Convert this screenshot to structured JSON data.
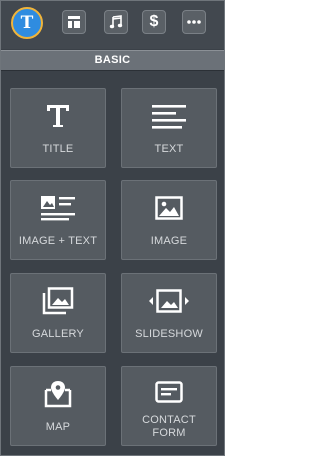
{
  "toolbar": {
    "buttons": [
      {
        "name": "text-elements",
        "glyph": "T",
        "active": true
      },
      {
        "name": "layout-elements",
        "active": false
      },
      {
        "name": "media-elements",
        "active": false
      },
      {
        "name": "commerce-elements",
        "glyph": "$",
        "active": false
      },
      {
        "name": "more-elements",
        "active": false
      }
    ]
  },
  "section": {
    "title": "BASIC"
  },
  "tiles": [
    {
      "label": "TITLE",
      "icon": "title-icon"
    },
    {
      "label": "TEXT",
      "icon": "text-lines-icon"
    },
    {
      "label": "IMAGE + TEXT",
      "icon": "image-text-icon"
    },
    {
      "label": "IMAGE",
      "icon": "image-icon"
    },
    {
      "label": "GALLERY",
      "icon": "gallery-icon"
    },
    {
      "label": "SLIDESHOW",
      "icon": "slideshow-icon"
    },
    {
      "label": "MAP",
      "icon": "map-pin-icon"
    },
    {
      "label_line1": "CONTACT",
      "label_line2": "FORM",
      "icon": "contact-form-icon"
    }
  ],
  "colors": {
    "panel_bg": "#3b4148",
    "tile_bg": "#555b61",
    "active_button": "#2f8ce0",
    "active_ring": "#f0b43a",
    "label_text": "#d6d9dc"
  }
}
